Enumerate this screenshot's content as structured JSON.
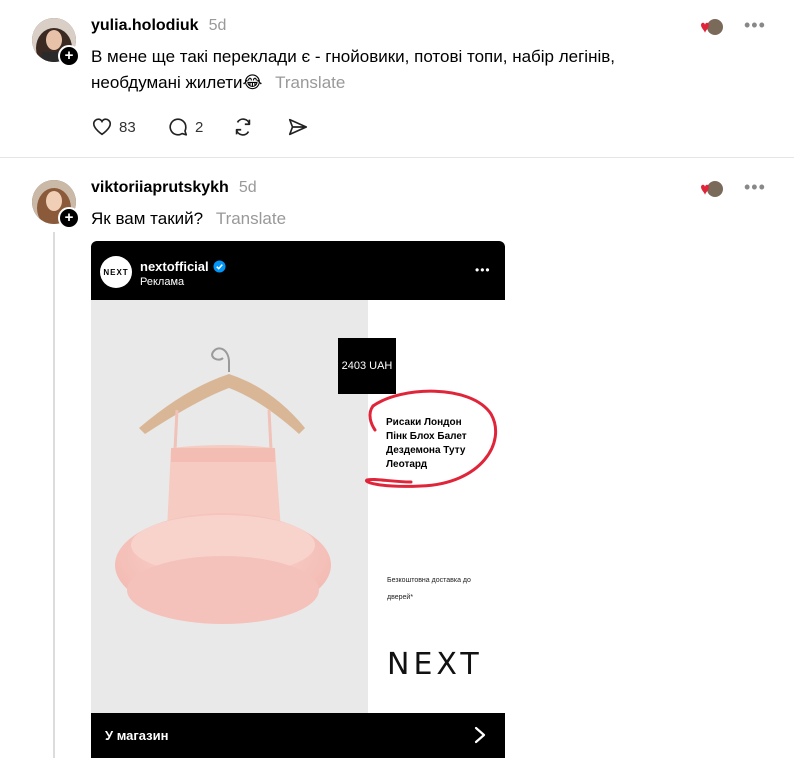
{
  "posts": [
    {
      "username": "yulia.holodiuk",
      "time": "5d",
      "text_line1": "В мене ще такі переклади є - гнойовики, потові топи, набір легінів,",
      "text_line2": "необдумані жилети😂",
      "translate_label": "Translate",
      "likes": "83",
      "replies": "2"
    },
    {
      "username": "viktoriiaprutskykh",
      "time": "5d",
      "text": "Як вам такий?",
      "translate_label": "Translate"
    }
  ],
  "embed": {
    "brand_logo": "NEXT",
    "account_name": "nextofficial",
    "sponsored_label": "Реклама",
    "price": "2403 UAH",
    "product_name": [
      "Рисаки Лондон",
      "Пінк Блох Балет",
      "Дездемона Туту",
      "Леотард"
    ],
    "delivery_line1": "Безкоштовна доставка до",
    "delivery_line2": "дверей*",
    "brand_wordmark": "NEXT",
    "shop_label": "У магазин"
  },
  "icons": [
    "heart-icon",
    "comment-icon",
    "repost-icon",
    "share-icon",
    "more-icon",
    "verified-icon",
    "chevron-right-icon",
    "plus-icon"
  ],
  "colors": {
    "accent_red": "#e0253a",
    "verified_blue": "#0095f6"
  }
}
